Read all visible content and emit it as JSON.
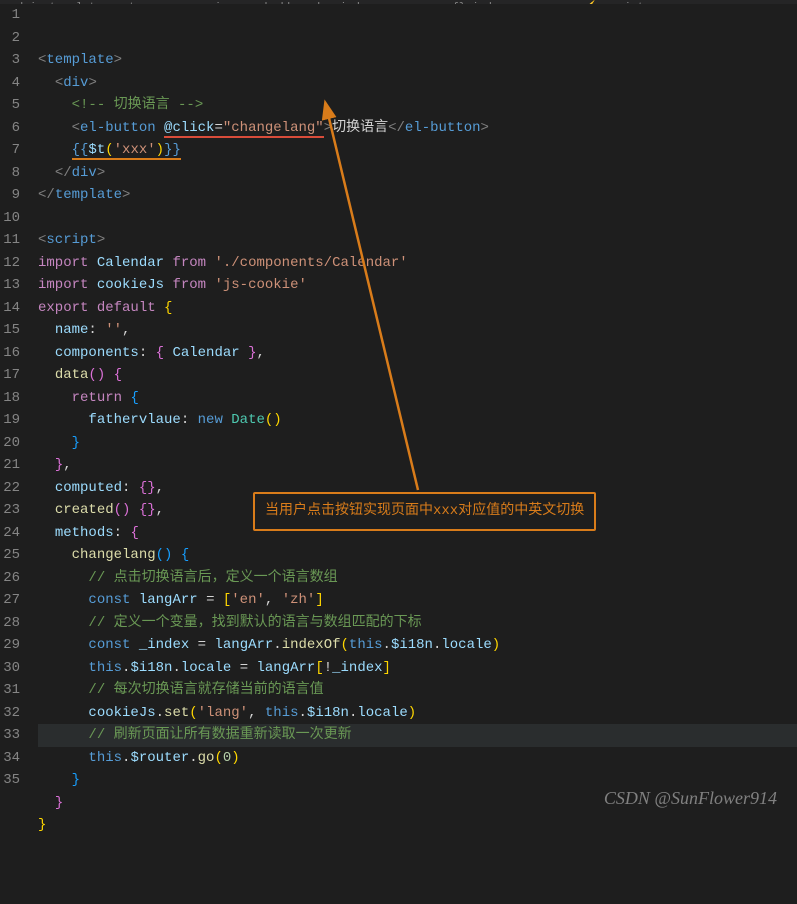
{
  "breadcrumb": "admin-template-master › src › views › dashboard › index copy.vue › {} index copy.vue › ⚡ script",
  "lineStart": 1,
  "lines": [
    {
      "n": 1,
      "html": "<span class='tag'>&lt;</span><span class='tagname'>template</span><span class='tag'>&gt;</span>"
    },
    {
      "n": 2,
      "html": "  <span class='tag'>&lt;</span><span class='tagname'>div</span><span class='tag'>&gt;</span>"
    },
    {
      "n": 3,
      "html": "    <span class='comment'>&lt;!-- 切换语言 --&gt;</span>"
    },
    {
      "n": 4,
      "html": "    <span class='tag'>&lt;</span><span class='tagname'>el-button</span> <span class='underline-red'><span class='attr'>@click</span><span class='punc'>=</span><span class='str'>\"changelang\"</span></span><span class='tag'>&gt;</span><span class='txt'>切换语言</span><span class='tag'>&lt;/</span><span class='tagname'>el-button</span><span class='tag'>&gt;</span>"
    },
    {
      "n": 5,
      "html": "    <span class='underline-orange'><span class='interp'>{{</span><span class='var'>$t</span><span class='brace-y'>(</span><span class='str'>'xxx'</span><span class='brace-y'>)</span><span class='interp'>}}</span></span>"
    },
    {
      "n": 6,
      "html": "  <span class='tag'>&lt;/</span><span class='tagname'>div</span><span class='tag'>&gt;</span>"
    },
    {
      "n": 7,
      "html": "<span class='tag'>&lt;/</span><span class='tagname'>template</span><span class='tag'>&gt;</span>"
    },
    {
      "n": 8,
      "html": ""
    },
    {
      "n": 9,
      "html": "<span class='tag'>&lt;</span><span class='tagname'>script</span><span class='tag'>&gt;</span>"
    },
    {
      "n": 10,
      "html": "<span class='kw'>import</span> <span class='var'>Calendar</span> <span class='kw'>from</span> <span class='str'>'./components/Calendar'</span>"
    },
    {
      "n": 11,
      "html": "<span class='kw'>import</span> <span class='var'>cookieJs</span> <span class='kw'>from</span> <span class='str'>'js-cookie'</span>"
    },
    {
      "n": 12,
      "html": "<span class='kw'>export</span> <span class='kw'>default</span> <span class='brace-y'>{</span>"
    },
    {
      "n": 13,
      "html": "  <span class='var'>name</span><span class='punc'>:</span> <span class='str'>''</span><span class='punc'>,</span>"
    },
    {
      "n": 14,
      "html": "  <span class='var'>components</span><span class='punc'>:</span> <span class='brace-p'>{</span> <span class='var'>Calendar</span> <span class='brace-p'>}</span><span class='punc'>,</span>"
    },
    {
      "n": 15,
      "html": "  <span class='fn'>data</span><span class='brace-p'>()</span> <span class='brace-p'>{</span>"
    },
    {
      "n": 16,
      "html": "    <span class='kw'>return</span> <span class='brace-b'>{</span>"
    },
    {
      "n": 17,
      "html": "      <span class='var'>fathervlaue</span><span class='punc'>:</span> <span class='kw2'>new</span> <span class='cls'>Date</span><span class='brace-y'>()</span>"
    },
    {
      "n": 18,
      "html": "    <span class='brace-b'>}</span>"
    },
    {
      "n": 19,
      "html": "  <span class='brace-p'>}</span><span class='punc'>,</span>"
    },
    {
      "n": 20,
      "html": "  <span class='var'>computed</span><span class='punc'>:</span> <span class='brace-p'>{}</span><span class='punc'>,</span>"
    },
    {
      "n": 21,
      "html": "  <span class='fn'>created</span><span class='brace-p'>()</span> <span class='brace-p'>{}</span><span class='punc'>,</span>"
    },
    {
      "n": 22,
      "html": "  <span class='var'>methods</span><span class='punc'>:</span> <span class='brace-p'>{</span>"
    },
    {
      "n": 23,
      "html": "    <span class='fn'>changelang</span><span class='brace-b'>()</span> <span class='brace-b'>{</span>"
    },
    {
      "n": 24,
      "html": "      <span class='comment'>// 点击切换语言后，定义一个语言数组</span>"
    },
    {
      "n": 25,
      "html": "      <span class='kw2'>const</span> <span class='var'>langArr</span> <span class='punc'>=</span> <span class='brace-y'>[</span><span class='str'>'en'</span><span class='punc'>,</span> <span class='str'>'zh'</span><span class='brace-y'>]</span>"
    },
    {
      "n": 26,
      "html": "      <span class='comment'>// 定义一个变量，找到默认的语言与数组匹配的下标</span>"
    },
    {
      "n": 27,
      "html": "      <span class='kw2'>const</span> <span class='var'>_index</span> <span class='punc'>=</span> <span class='var'>langArr</span><span class='punc'>.</span><span class='fn'>indexOf</span><span class='brace-y'>(</span><span class='kw2'>this</span><span class='punc'>.</span><span class='var'>$i18n</span><span class='punc'>.</span><span class='var'>locale</span><span class='brace-y'>)</span>"
    },
    {
      "n": 28,
      "html": "      <span class='kw2'>this</span><span class='punc'>.</span><span class='var'>$i18n</span><span class='punc'>.</span><span class='var'>locale</span> <span class='punc'>=</span> <span class='var'>langArr</span><span class='brace-y'>[</span><span class='punc'>!</span><span class='var'>_index</span><span class='brace-y'>]</span>"
    },
    {
      "n": 29,
      "html": "      <span class='comment'>// 每次切换语言就存储当前的语言值</span>"
    },
    {
      "n": 30,
      "html": "      <span class='var'>cookieJs</span><span class='punc'>.</span><span class='fn'>set</span><span class='brace-y'>(</span><span class='str'>'lang'</span><span class='punc'>,</span> <span class='kw2'>this</span><span class='punc'>.</span><span class='var'>$i18n</span><span class='punc'>.</span><span class='var'>locale</span><span class='brace-y'>)</span>"
    },
    {
      "n": 31,
      "html": "      <span class='comment'>// 刷新页面让所有数据重新读取一次更新</span>",
      "hl": true
    },
    {
      "n": 32,
      "html": "      <span class='kw2'>this</span><span class='punc'>.</span><span class='var'>$router</span><span class='punc'>.</span><span class='fn'>go</span><span class='brace-y'>(</span><span class='num'>0</span><span class='brace-y'>)</span>"
    },
    {
      "n": 33,
      "html": "    <span class='brace-b'>}</span>"
    },
    {
      "n": 34,
      "html": "  <span class='brace-p'>}</span>"
    },
    {
      "n": 35,
      "html": "<span class='brace-y'>}</span>"
    }
  ],
  "annotation": "当用户点击按钮实现页面中xxx对应值的中英文切换",
  "watermark": "CSDN @SunFlower914"
}
